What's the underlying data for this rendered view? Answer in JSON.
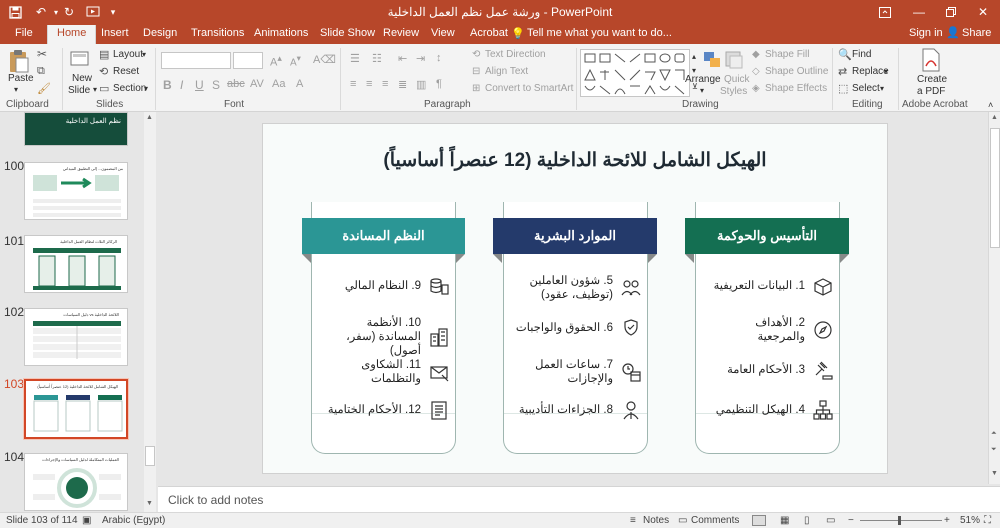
{
  "window": {
    "title": "ورشة عمل نظم العمل الداخلية - PowerPoint",
    "sign_in": "Sign in",
    "share": "Share"
  },
  "tabs": [
    "File",
    "Home",
    "Insert",
    "Design",
    "Transitions",
    "Animations",
    "Slide Show",
    "Review",
    "View",
    "Acrobat"
  ],
  "tell_me": "Tell me what you want to do...",
  "ribbon": {
    "clipboard": {
      "label": "Clipboard",
      "paste": "Paste"
    },
    "slides": {
      "label": "Slides",
      "new_slide": "New",
      "new_slide2": "Slide",
      "layout": "Layout",
      "reset": "Reset",
      "section": "Section"
    },
    "font": {
      "label": "Font"
    },
    "paragraph": {
      "label": "Paragraph",
      "text_direction": "Text Direction",
      "align_text": "Align Text",
      "convert": "Convert to SmartArt"
    },
    "drawing": {
      "label": "Drawing",
      "arrange": "Arrange",
      "quick_styles": "Quick",
      "quick_styles2": "Styles",
      "shape_fill": "Shape Fill",
      "shape_outline": "Shape Outline",
      "shape_effects": "Shape Effects"
    },
    "editing": {
      "label": "Editing",
      "find": "Find",
      "replace": "Replace",
      "select": "Select"
    },
    "acrobat": {
      "label": "Adobe Acrobat",
      "create_pdf": "Create",
      "create_pdf2": "a PDF"
    }
  },
  "thumbnails": [
    {
      "number": "",
      "title": "نظم العمل الداخلية"
    },
    {
      "number": "100",
      "title": "من المضمون... إلى التطبيق الميداني"
    },
    {
      "number": "101",
      "title": "الركائز الثلاث لنظام العمل الداخلية"
    },
    {
      "number": "102",
      "title": "اللائحة الداخلية vs دليل السياسات"
    },
    {
      "number": "103",
      "title": "الهيكل الشامل للائحة الداخلية (12 عنصراً أساسياً)"
    },
    {
      "number": "104",
      "title": "العمليات المتكاملة لدليل السياسات والإجراءات"
    }
  ],
  "slide": {
    "title": "الهيكل الشامل للائحة الداخلية (12 عنصراً أساسياً)",
    "columns": [
      {
        "heading": "النظم المساندة",
        "color": "#2b9695",
        "items": [
          "9. النظام المالي",
          "10. الأنظمة المساندة (سفر، أصول)",
          "11. الشكاوى والتظلمات",
          "12. الأحكام الختامية"
        ],
        "icons": [
          "coins-icon",
          "building-icon",
          "mail-icon",
          "document-icon"
        ]
      },
      {
        "heading": "الموارد البشرية",
        "color": "#243a6b",
        "items": [
          "5. شؤون العاملين (توظيف، عقود)",
          "6. الحقوق والواجبات",
          "7. ساعات العمل والإجازات",
          "8. الجزاءات التأديبية"
        ],
        "icons": [
          "people-icon",
          "hand-shield-icon",
          "clock-calendar-icon",
          "judge-icon"
        ]
      },
      {
        "heading": "التأسيس والحوكمة",
        "color": "#146f52",
        "items": [
          "1. البيانات التعريفية",
          "2. الأهداف والمرجعية",
          "3. الأحكام العامة",
          "4. الهيكل التنظيمي"
        ],
        "icons": [
          "box-icon",
          "compass-icon",
          "gavel-icon",
          "org-chart-icon"
        ]
      }
    ]
  },
  "notes_placeholder": "Click to add notes",
  "status": {
    "slide_counter": "Slide 103 of 114",
    "language": "Arabic (Egypt)",
    "notes": "Notes",
    "comments": "Comments",
    "zoom": "51%"
  },
  "colors": {
    "accent": "#b7472a",
    "selection": "#d24726"
  }
}
